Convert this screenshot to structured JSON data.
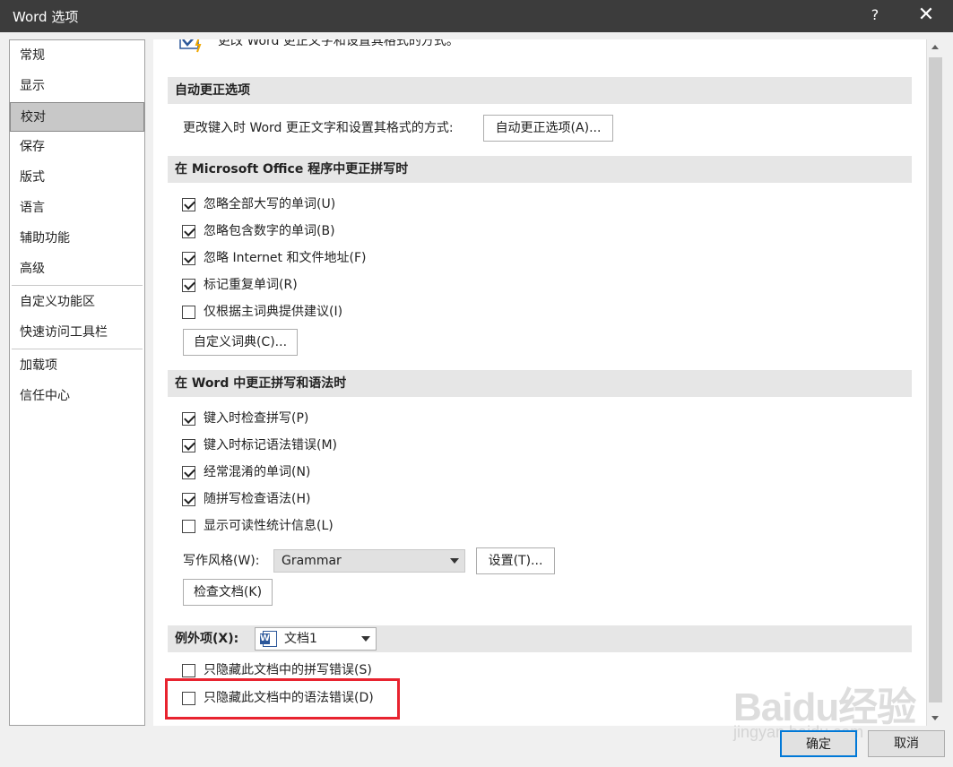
{
  "window": {
    "title": "Word 选项",
    "help": "?",
    "close": "✕"
  },
  "sidebar": {
    "items": [
      {
        "label": "常规"
      },
      {
        "label": "显示"
      },
      {
        "label": "校对"
      },
      {
        "label": "保存"
      },
      {
        "label": "版式"
      },
      {
        "label": "语言"
      },
      {
        "label": "辅助功能"
      },
      {
        "label": "高级"
      },
      {
        "label": "自定义功能区"
      },
      {
        "label": "快速访问工具栏"
      },
      {
        "label": "加载项"
      },
      {
        "label": "信任中心"
      }
    ],
    "selected": "校对"
  },
  "top_row": {
    "text": "更改 Word 更正文字和设置其格式的方式。"
  },
  "autocorrect": {
    "section_title": "自动更正选项",
    "label": "更改键入时 Word 更正文字和设置其格式的方式:",
    "button": "自动更正选项(A)..."
  },
  "office_spelling": {
    "section_title": "在 Microsoft Office 程序中更正拼写时",
    "options": [
      {
        "label": "忽略全部大写的单词(U)",
        "checked": true
      },
      {
        "label": "忽略包含数字的单词(B)",
        "checked": true
      },
      {
        "label": "忽略 Internet 和文件地址(F)",
        "checked": true
      },
      {
        "label": "标记重复单词(R)",
        "checked": true
      },
      {
        "label": "仅根据主词典提供建议(I)",
        "checked": false
      }
    ],
    "custom_dict_button": "自定义词典(C)..."
  },
  "word_grammar": {
    "section_title": "在 Word 中更正拼写和语法时",
    "options": [
      {
        "label": "键入时检查拼写(P)",
        "checked": true
      },
      {
        "label": "键入时标记语法错误(M)",
        "checked": true
      },
      {
        "label": "经常混淆的单词(N)",
        "checked": true
      },
      {
        "label": "随拼写检查语法(H)",
        "checked": true
      },
      {
        "label": "显示可读性统计信息(L)",
        "checked": false
      }
    ],
    "style_label": "写作风格(W):",
    "style_value": "Grammar",
    "settings_button": "设置(T)...",
    "check_doc_button": "检查文档(K)"
  },
  "exceptions": {
    "label": "例外项(X):",
    "doc_value": "文档1",
    "options": [
      {
        "label": "只隐藏此文档中的拼写错误(S)",
        "checked": false
      },
      {
        "label": "只隐藏此文档中的语法错误(D)",
        "checked": false
      }
    ]
  },
  "footer": {
    "ok": "确定",
    "cancel": "取消"
  },
  "watermark": {
    "text": "Baidu经验",
    "sub": "jingyan.baidu.com"
  },
  "colors": {
    "titlebar": "#3c3c3c",
    "highlight": "#e8232f",
    "accent": "#0078d7"
  }
}
